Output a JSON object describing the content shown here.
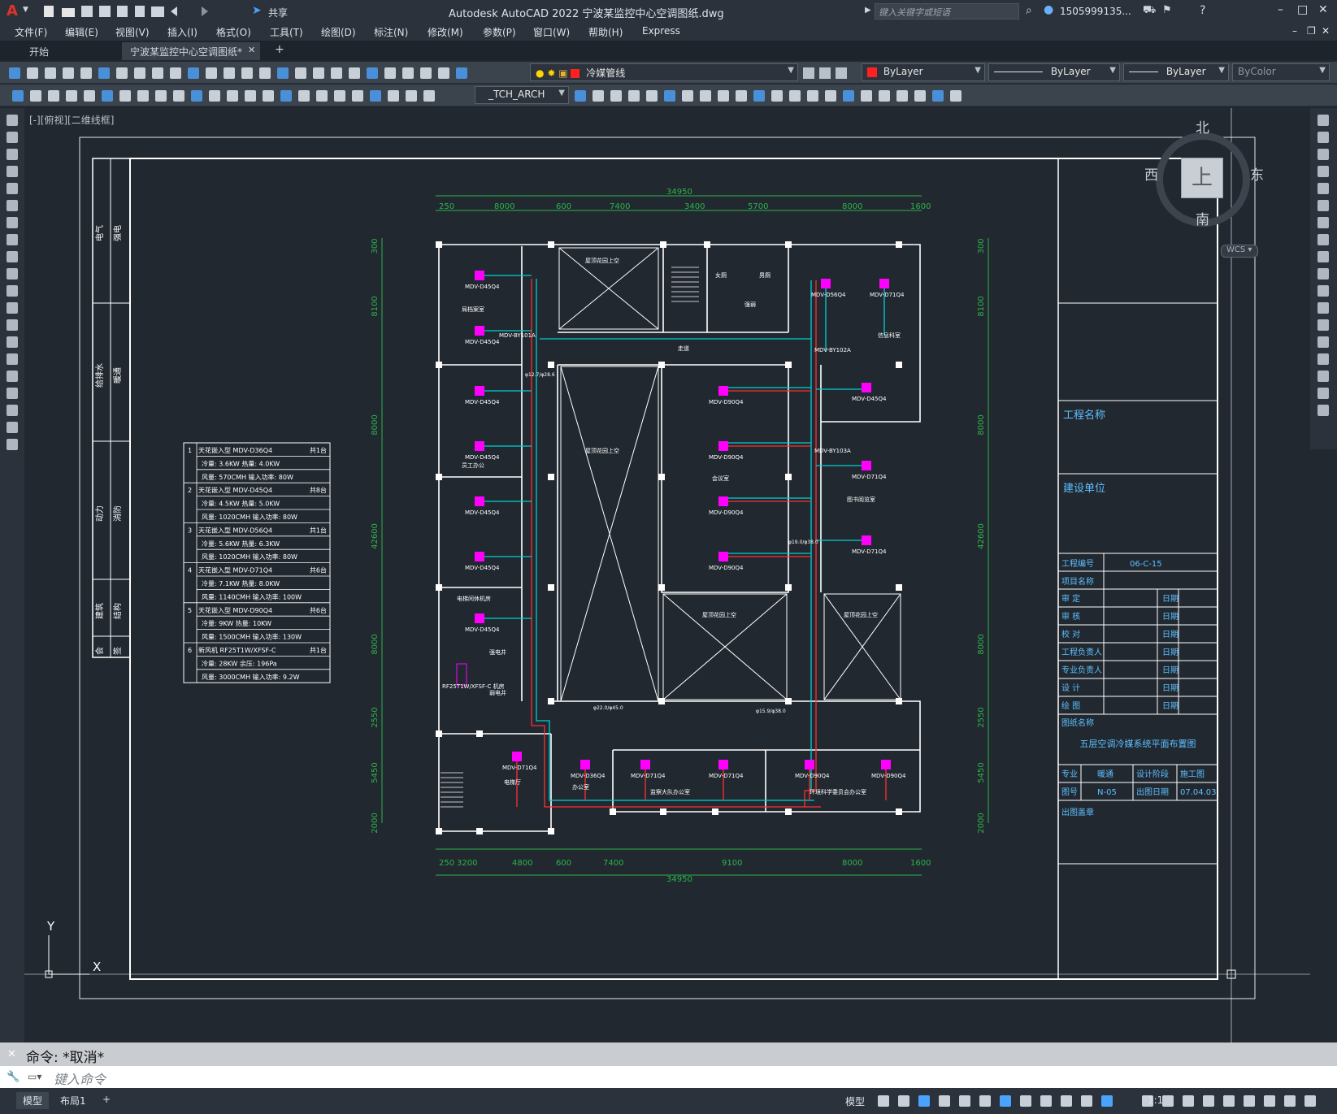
{
  "app": {
    "window_title": "Autodesk AutoCAD 2022    宁波某监控中心空调图纸.dwg",
    "search_placeholder": "键入关键字或短语",
    "user": "1505999135...",
    "share_label": "共享"
  },
  "menu": [
    "文件(F)",
    "编辑(E)",
    "视图(V)",
    "插入(I)",
    "格式(O)",
    "工具(T)",
    "绘图(D)",
    "标注(N)",
    "修改(M)",
    "参数(P)",
    "窗口(W)",
    "帮助(H)",
    "Express"
  ],
  "tabs": {
    "start": "开始",
    "active": "宁波某监控中心空调图纸*",
    "close": "✕",
    "add": "+"
  },
  "layer_dropdown": "冷媒管线",
  "color_dropdown": "ByLayer",
  "linetype_dropdown": "ByLayer",
  "lineweight_dropdown": "ByLayer",
  "plotstyle_dropdown": "ByColor",
  "style_dropdown": "_TCH_ARCH",
  "viewport_label": "[-][俯视][二维线框]",
  "viewcube": {
    "north": "北",
    "south": "南",
    "west": "西",
    "east": "东",
    "top": "上",
    "wcs": "WCS"
  },
  "ucs": {
    "x": "X",
    "y": "Y"
  },
  "command": {
    "history": "命令: *取消*",
    "placeholder": "键入命令"
  },
  "status_tabs": {
    "model": "模型",
    "layout1": "布局1",
    "add": "+"
  },
  "status_right": {
    "model_label": "模型",
    "scale": "1:1"
  },
  "drawing": {
    "top_dims": [
      "34950",
      "250",
      "8000",
      "600",
      "7400",
      "3400",
      "5700",
      "8000",
      "1600"
    ],
    "bottom_dims": [
      "250",
      "3200",
      "4800",
      "600",
      "7400",
      "9100",
      "8000",
      "1600",
      "34950"
    ],
    "left_dims": [
      "300",
      "8100",
      "8000",
      "42600",
      "8000",
      "2550",
      "5450",
      "2000"
    ],
    "right_dims": [
      "300",
      "8100",
      "8000",
      "42600",
      "8000",
      "2550",
      "5450",
      "2000"
    ],
    "rooms": [
      "屋顶花园上空",
      "女厕",
      "男厕",
      "强弱",
      "走道",
      "屋顶花园上空",
      "会议室",
      "员工办公",
      "电梯间休机房",
      "屋顶花园上空",
      "屋顶花园上空",
      "图书阅览室",
      "信息科室",
      "局档案室",
      "电梯厅",
      "办公室",
      "监察大队办公室",
      "环境科学委员会办公室",
      "强电井",
      "弱电井",
      "RF25T1W/XFSF-C 机房"
    ],
    "indoor_units": [
      "MDV-D45Q4",
      "MDV-D45Q4",
      "MDV-D45Q4",
      "MDV-D45Q4",
      "MDV-D45Q4",
      "MDV-D45Q4",
      "MDV-D45Q4",
      "MDV-D56Q4",
      "MDV-D71Q4",
      "MDV-D45Q4",
      "MDV-D90Q4",
      "MDV-D90Q4",
      "MDV-D90Q4",
      "MDV-D90Q4",
      "MDV-D71Q4",
      "MDV-D71Q4",
      "MDV-D71Q4",
      "MDV-D36Q4",
      "MDV-D71Q4",
      "MDV-D71Q4",
      "MDV-D90Q4",
      "MDV-D90Q4"
    ],
    "branch_labels": [
      "MDV-BY101A",
      "MDV-BY102A",
      "MDV-BY103A"
    ],
    "pipe_labels": [
      "φ12.7/φ28.6",
      "φ15.9/φ38.0",
      "φ22.0/φ45.0",
      "φ19.0/φ38.0"
    ]
  },
  "equipment_table": [
    [
      "1",
      "天花嵌入型  MDV-D36Q4",
      "共1台"
    ],
    [
      "",
      "冷量: 3.6KW    热量: 4.0KW",
      ""
    ],
    [
      "",
      "风量: 570CMH    输入功率: 80W",
      ""
    ],
    [
      "2",
      "天花嵌入型  MDV-D45Q4",
      "共8台"
    ],
    [
      "",
      "冷量: 4.5KW    热量: 5.0KW",
      ""
    ],
    [
      "",
      "风量: 1020CMH    输入功率: 80W",
      ""
    ],
    [
      "3",
      "天花嵌入型  MDV-D56Q4",
      "共1台"
    ],
    [
      "",
      "冷量: 5.6KW    热量: 6.3KW",
      ""
    ],
    [
      "",
      "风量: 1020CMH    输入功率: 80W",
      ""
    ],
    [
      "4",
      "天花嵌入型  MDV-D71Q4",
      "共6台"
    ],
    [
      "",
      "冷量: 7.1KW    热量: 8.0KW",
      ""
    ],
    [
      "",
      "风量: 1140CMH    输入功率: 100W",
      ""
    ],
    [
      "5",
      "天花嵌入型  MDV-D90Q4",
      "共6台"
    ],
    [
      "",
      "冷量: 9KW    热量: 10KW",
      ""
    ],
    [
      "",
      "风量: 1500CMH    输入功率: 130W",
      ""
    ],
    [
      "6",
      "新风机    RF25T1W/XFSF-C",
      "共1台"
    ],
    [
      "",
      "冷量: 28KW    余压: 196Pa",
      ""
    ],
    [
      "",
      "风量: 3000CMH    输入功率: 9.2W",
      ""
    ]
  ],
  "left_strip_labels": [
    "电气",
    "强电",
    "给排水",
    "暖通",
    "动力",
    "消防",
    "建筑",
    "结构",
    "会",
    "签"
  ],
  "title_block": {
    "project_name": "工程名称",
    "client": "建设单位",
    "project_no_label": "工程编号",
    "project_no": "06-C-15",
    "item_name_label": "项目名称",
    "sign_rows": [
      "审    定",
      "审    核",
      "校    对",
      "工程负责人",
      "专业负责人",
      "设    计",
      "绘    图"
    ],
    "date_label": "日期",
    "drawing_name_label": "图纸名称",
    "drawing_name": "五层空调冷媒系统平面布置图",
    "discipline_label": "专业",
    "discipline": "暖通",
    "stage_label": "设计阶段",
    "stage": "施工图",
    "drawing_no_label": "图号",
    "drawing_no": "N-05",
    "issue_date_label": "出图日期",
    "issue_date": "07.04.03",
    "stamp_label": "出图盖章"
  },
  "colors": {
    "accent": "#1a73e8",
    "unit_fill": "#ff00ff",
    "pipe_red": "#ff3030",
    "pipe_cyan": "#00d0d0",
    "dim_green": "#2fb34a",
    "wall": "#ffffff"
  }
}
